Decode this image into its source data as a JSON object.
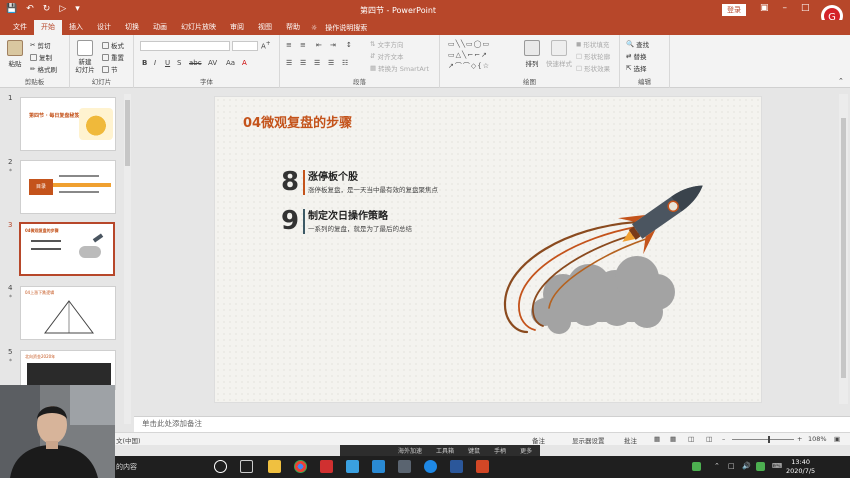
{
  "app": {
    "window_title": "第四节 - PowerPoint",
    "login_label": "登录"
  },
  "ribbon_tabs": [
    "文件",
    "开始",
    "插入",
    "设计",
    "切换",
    "动画",
    "幻灯片放映",
    "审阅",
    "视图",
    "帮助"
  ],
  "tell_me": "操作说明搜索",
  "ribbon": {
    "clipboard": {
      "paste": "粘贴",
      "cut": "剪切",
      "copy": "复制",
      "format_painter": "格式刷",
      "label": "剪贴板"
    },
    "slides": {
      "new_slide": "新建\n幻灯片",
      "layout": "板式",
      "reset": "重置",
      "section": "节",
      "label": "幻灯片"
    },
    "font": {
      "label": "字体"
    },
    "paragraph": {
      "text_direction": "文字方向",
      "align_text": "对齐文本",
      "smartart": "转换为 SmartArt",
      "label": "段落"
    },
    "drawing": {
      "arrange": "排列",
      "quick_styles": "快速样式",
      "shape_fill": "形状填充",
      "shape_outline": "形状轮廓",
      "shape_effects": "形状效果",
      "label": "绘图"
    },
    "editing": {
      "find": "查找",
      "replace": "替换",
      "select": "选择",
      "label": "编辑"
    }
  },
  "thumbnails": [
    {
      "num": "1",
      "title": "第四节 · 每日复盘秘笈"
    },
    {
      "num": "2",
      "title": "目录"
    },
    {
      "num": "3",
      "title": "04微观复盘的步骤"
    },
    {
      "num": "4",
      "title": "04上涨下跌逻辑"
    },
    {
      "num": "5",
      "title": "北向资金2020年"
    }
  ],
  "slide": {
    "title": "04微观复盘的步骤",
    "items": [
      {
        "num": "8",
        "heading": "涨停板个股",
        "desc": "涨停板复盘，是一天当中最有效的复盘聚焦点",
        "bar_color": "#c4531b"
      },
      {
        "num": "9",
        "heading": "制定次日操作策略",
        "desc": "一系列的复盘，就是为了最后的总结",
        "bar_color": "#3d5a66"
      }
    ]
  },
  "notes_placeholder": "单击此处添加备注",
  "status": {
    "lang": "文(中国)",
    "notes": "备注",
    "display": "显示器设置",
    "comments": "批注",
    "zoom": "108%"
  },
  "ime_bar": [
    "海外加速",
    "工具箱",
    "键鼠",
    "手柄",
    "更多"
  ],
  "taskbar": {
    "search_text": "的内容",
    "time": "13:40",
    "date": "2020/7/5"
  },
  "colors": {
    "accent": "#b7472a",
    "title": "#c4531b"
  }
}
